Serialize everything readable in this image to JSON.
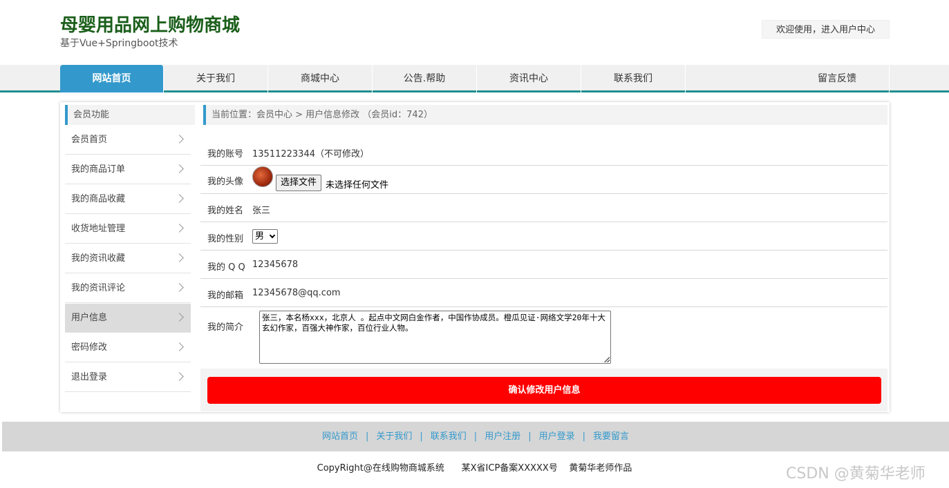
{
  "header": {
    "title": "母婴用品网上购物商城",
    "subtitle": "基于Vue+Springboot技术",
    "user_center": "欢迎使用，进入用户中心"
  },
  "nav": {
    "items": [
      "网站首页",
      "关于我们",
      "商城中心",
      "公告.帮助",
      "资讯中心",
      "联系我们",
      "留言反馈"
    ],
    "active_index": 0
  },
  "sidebar": {
    "title": "会员功能",
    "items": [
      "会员首页",
      "我的商品订单",
      "我的商品收藏",
      "收货地址管理",
      "我的资讯收藏",
      "我的资讯评论",
      "用户信息",
      "密码修改",
      "退出登录"
    ],
    "active_index": 6
  },
  "breadcrumb": "当前位置：会员中心 > 用户信息修改 （会员id：742）",
  "form": {
    "account_label": "我的账号",
    "account_value": "13511223344（不可修改）",
    "avatar_label": "我的头像",
    "file_button": "选择文件",
    "file_status": "未选择任何文件",
    "name_label": "我的姓名",
    "name_value": "张三",
    "sex_label": "我的性别",
    "sex_value": "男",
    "qq_label": "我的 Q Q",
    "qq_value": "12345678",
    "email_label": "我的邮箱",
    "email_value": "12345678@qq.com",
    "intro_label": "我的简介",
    "intro_value": "张三，本名杨xxx，北京人 。起点中文网白金作者，中国作协成员。橙瓜见证·网络文学20年十大玄幻作家，百强大神作家，百位行业人物。",
    "submit": "确认修改用户信息"
  },
  "footer": {
    "links": [
      "网站首页",
      "关于我们",
      "联系我们",
      "用户注册",
      "用户登录",
      "我要留言"
    ],
    "separator": "|",
    "copyright": "CopyRight@在线购物商城系统      某X省ICP备案XXXXX号    黄菊华老师作品"
  },
  "watermark": "CSDN @黄菊华老师",
  "colors": {
    "brand_title": "#1a5e1a",
    "nav_active": "#3399cc",
    "nav_border": "#1f8e8e",
    "submit_button": "#ff0000",
    "link": "#3399cc"
  }
}
